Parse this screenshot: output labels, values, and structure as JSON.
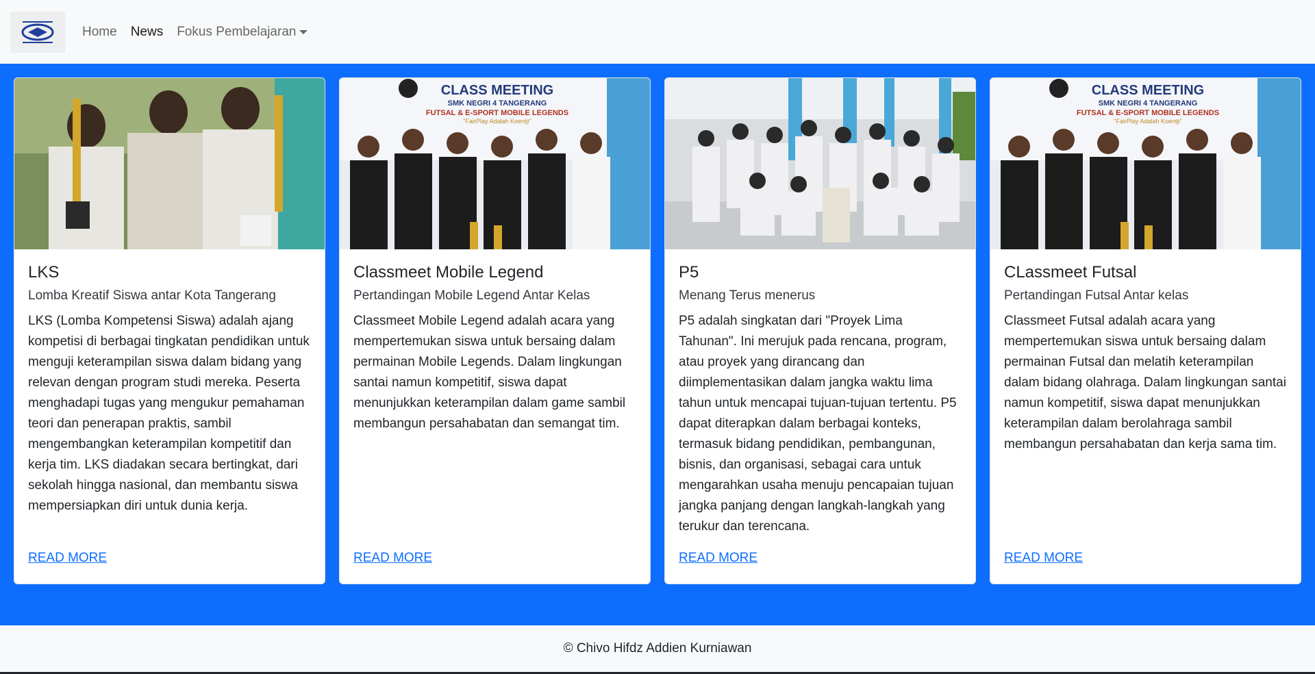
{
  "navbar": {
    "logo_icon": "school-logo",
    "links": [
      {
        "label": "Home"
      },
      {
        "label": "News"
      },
      {
        "label": "Fokus Pembelajaran"
      }
    ]
  },
  "cards": [
    {
      "title": "LKS",
      "subtitle": "Lomba Kreatif Siswa antar Kota Tangerang",
      "text": "LKS (Lomba Kompetensi Siswa) adalah ajang kompetisi di berbagai tingkatan pendidikan untuk menguji keterampilan siswa dalam bidang yang relevan dengan program studi mereka. Peserta menghadapi tugas yang mengukur pemahaman teori dan penerapan praktis, sambil mengembangkan keterampilan kompetitif dan kerja tim. LKS diadakan secara bertingkat, dari sekolah hingga nasional, dan membantu siswa mempersiapkan diri untuk dunia kerja.",
      "link": "READ MORE"
    },
    {
      "title": "Classmeet Mobile Legend",
      "subtitle": "Pertandingan Mobile Legend Antar Kelas",
      "text": "Classmeet Mobile Legend adalah acara yang mempertemukan siswa untuk bersaing dalam permainan Mobile Legends. Dalam lingkungan santai namun kompetitif, siswa dapat menunjukkan keterampilan dalam game sambil membangun persahabatan dan semangat tim.",
      "link": "READ MORE",
      "banner": {
        "line1": "CLASS MEETING",
        "line2": "SMK NEGRI 4 TANGERANG",
        "line3": "FUTSAL & E-SPORT MOBILE LEGENDS",
        "line4": "\"FairPlay Adalah Koentji\""
      }
    },
    {
      "title": "P5",
      "subtitle": "Menang Terus menerus",
      "text": "P5 adalah singkatan dari \"Proyek Lima Tahunan\". Ini merujuk pada rencana, program, atau proyek yang dirancang dan diimplementasikan dalam jangka waktu lima tahun untuk mencapai tujuan-tujuan tertentu. P5 dapat diterapkan dalam berbagai konteks, termasuk bidang pendidikan, pembangunan, bisnis, dan organisasi, sebagai cara untuk mengarahkan usaha menuju pencapaian tujuan jangka panjang dengan langkah-langkah yang terukur dan terencana.",
      "link": "READ MORE"
    },
    {
      "title": "CLassmeet Futsal",
      "subtitle": "Pertandingan Futsal Antar kelas",
      "text": "Classmeet Futsal adalah acara yang mempertemukan siswa untuk bersaing dalam permainan Futsal dan melatih keterampilan dalam bidang olahraga. Dalam lingkungan santai namun kompetitif, siswa dapat menunjukkan keterampilan dalam berolahraga sambil membangun persahabatan dan kerja sama tim.",
      "link": "READ MORE",
      "banner": {
        "line1": "CLASS MEETING",
        "line2": "SMK NEGRI 4 TANGERANG",
        "line3": "FUTSAL & E-SPORT MOBILE LEGENDS",
        "line4": "\"FairPlay Adalah Koentji\""
      }
    }
  ],
  "footer": {
    "text": "© Chivo Hifdz Addien Kurniawan"
  },
  "colors": {
    "primary": "#0d6efd",
    "navbar_bg": "#f8f9fa"
  }
}
